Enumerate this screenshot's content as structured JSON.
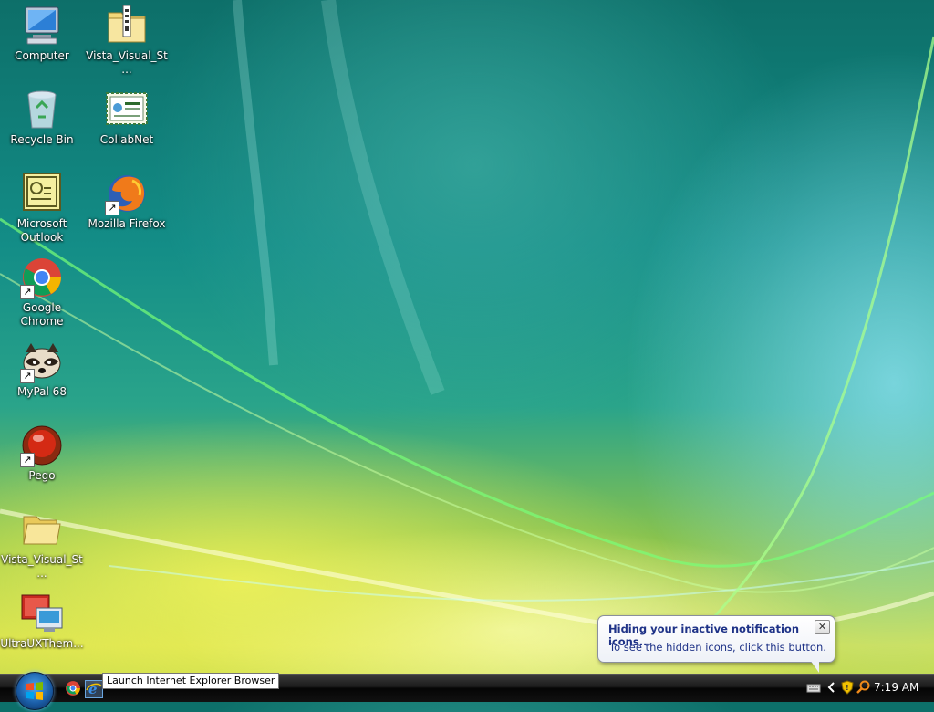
{
  "desktop": {
    "icons": [
      {
        "label": "Computer",
        "icon": "computer-icon"
      },
      {
        "label": "Vista_Visual_St...",
        "icon": "zip-folder-icon"
      },
      {
        "label": "Recycle Bin",
        "icon": "recycle-bin-icon"
      },
      {
        "label": "CollabNet",
        "icon": "certificate-icon"
      },
      {
        "label": "Microsoft Outlook",
        "icon": "outlook-icon"
      },
      {
        "label": "Mozilla Firefox",
        "icon": "firefox-icon"
      },
      {
        "label": "Google Chrome",
        "icon": "chrome-icon"
      },
      {
        "label": "MyPal 68",
        "icon": "mypal-raccoon-icon"
      },
      {
        "label": "Pego",
        "icon": "pego-icon"
      },
      {
        "label": "Vista_Visual_St...",
        "icon": "folder-icon"
      },
      {
        "label": "UltraUXThem...",
        "icon": "theme-app-icon"
      }
    ]
  },
  "taskbar": {
    "tooltip": "Launch Internet Explorer Browser",
    "clock": "7:19 AM"
  },
  "balloon": {
    "title": "Hiding your inactive notification icons...",
    "body": "To see the hidden icons, click this button.",
    "close_glyph": "✕"
  },
  "colors": {
    "balloon_text": "#1e3287",
    "taskbar": "#111111"
  }
}
